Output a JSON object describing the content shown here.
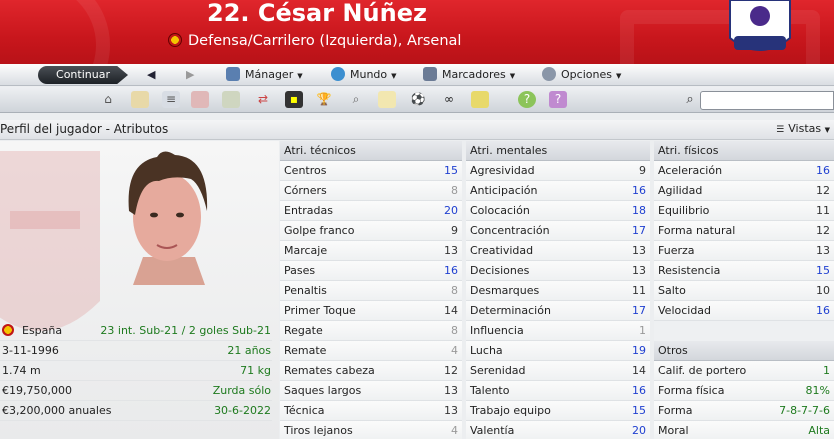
{
  "header": {
    "title": "22. César Núñez",
    "subtitle": "Defensa/Carrilero (Izquierda), Arsenal"
  },
  "toolbar": {
    "continue_label": "Continuar",
    "menus": [
      {
        "label": "Mánager",
        "icon": "manager-icon"
      },
      {
        "label": "Mundo",
        "icon": "globe-icon"
      },
      {
        "label": "Marcadores",
        "icon": "bookmark-icon"
      },
      {
        "label": "Opciones",
        "icon": "options-gear-icon"
      }
    ]
  },
  "subheader": {
    "breadcrumb": "Perfil del jugador - Atributos",
    "views_label": "Vistas"
  },
  "profile": {
    "nation": "España",
    "caps": "23 int. Sub-21 / 2 goles Sub-21",
    "dob": "3-11-1996",
    "age": "21 años",
    "height": "1.74 m",
    "weight": "71 kg",
    "value": "€19,750,000",
    "foot": "Zurda sólo",
    "wage": "€3,200,000 anuales",
    "contract": "30-6-2022"
  },
  "technical": {
    "title": "Atri. técnicos",
    "rows": [
      {
        "name": "Centros",
        "value": "15"
      },
      {
        "name": "Córners",
        "value": "8"
      },
      {
        "name": "Entradas",
        "value": "20"
      },
      {
        "name": "Golpe franco",
        "value": "9"
      },
      {
        "name": "Marcaje",
        "value": "13"
      },
      {
        "name": "Pases",
        "value": "16"
      },
      {
        "name": "Penaltis",
        "value": "8"
      },
      {
        "name": "Primer Toque",
        "value": "14"
      },
      {
        "name": "Regate",
        "value": "8"
      },
      {
        "name": "Remate",
        "value": "4"
      },
      {
        "name": "Remates cabeza",
        "value": "12"
      },
      {
        "name": "Saques largos",
        "value": "13"
      },
      {
        "name": "Técnica",
        "value": "13"
      },
      {
        "name": "Tiros lejanos",
        "value": "4"
      }
    ]
  },
  "mental": {
    "title": "Atri. mentales",
    "rows": [
      {
        "name": "Agresividad",
        "value": "9"
      },
      {
        "name": "Anticipación",
        "value": "16"
      },
      {
        "name": "Colocación",
        "value": "18"
      },
      {
        "name": "Concentración",
        "value": "17"
      },
      {
        "name": "Creatividad",
        "value": "13"
      },
      {
        "name": "Decisiones",
        "value": "13"
      },
      {
        "name": "Desmarques",
        "value": "11"
      },
      {
        "name": "Determinación",
        "value": "17"
      },
      {
        "name": "Influencia",
        "value": "1"
      },
      {
        "name": "Lucha",
        "value": "19"
      },
      {
        "name": "Serenidad",
        "value": "14"
      },
      {
        "name": "Talento",
        "value": "16"
      },
      {
        "name": "Trabajo equipo",
        "value": "15"
      },
      {
        "name": "Valentía",
        "value": "20"
      }
    ]
  },
  "physical": {
    "title": "Atri. físicos",
    "rows": [
      {
        "name": "Aceleración",
        "value": "16"
      },
      {
        "name": "Agilidad",
        "value": "12"
      },
      {
        "name": "Equilibrio",
        "value": "11"
      },
      {
        "name": "Forma natural",
        "value": "12"
      },
      {
        "name": "Fuerza",
        "value": "13"
      },
      {
        "name": "Resistencia",
        "value": "15"
      },
      {
        "name": "Salto",
        "value": "10"
      },
      {
        "name": "Velocidad",
        "value": "16"
      }
    ]
  },
  "others": {
    "title": "Otros",
    "rows": [
      {
        "name": "Calif. de portero",
        "value": "1"
      },
      {
        "name": "Forma física",
        "value": "81%"
      },
      {
        "name": "Forma",
        "value": "7-8-7-7-6"
      },
      {
        "name": "Moral",
        "value": "Alta"
      }
    ]
  },
  "colors": {
    "header_red": "#c8161c",
    "attr_high": "#1f3fd0",
    "attr_mid": "#333333",
    "attr_low": "#999999",
    "info_green": "#1e7a1e"
  }
}
